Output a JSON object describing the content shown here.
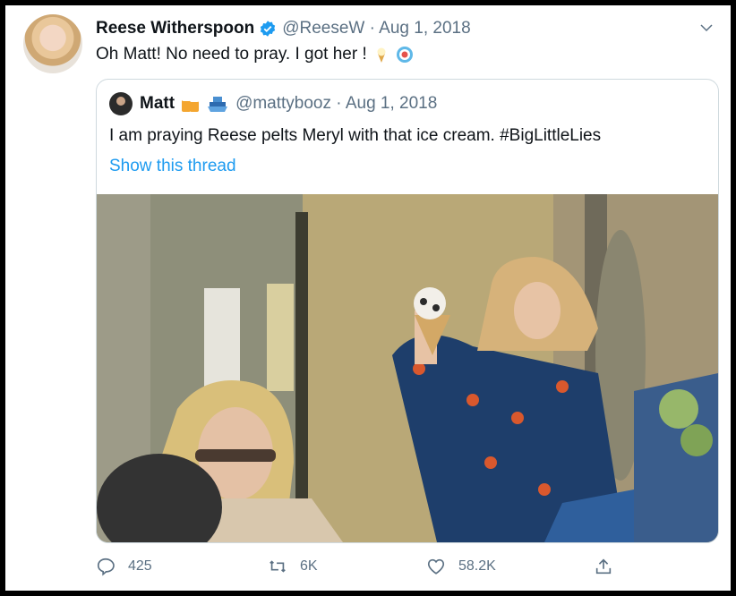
{
  "tweet": {
    "display_name": "Reese Witherspoon",
    "handle_date": "@ReeseW · Aug 1, 2018",
    "text": "Oh Matt! No need to pray. I got her !"
  },
  "quoted": {
    "display_name": "Matt",
    "handle_date": "@mattybooz · Aug 1, 2018",
    "text": "I am praying Reese pelts Meryl with that ice cream. #BigLittleLies",
    "show_thread": "Show this thread"
  },
  "actions": {
    "replies": "425",
    "retweets": "6K",
    "likes": "58.2K"
  },
  "colors": {
    "verified": "#1d9bf0",
    "link": "#1d9bf0",
    "muted": "#5b7083"
  },
  "icons": [
    "verified-badge-icon",
    "chevron-down-icon",
    "ice-cream-emoji",
    "target-emoji",
    "beer-emoji",
    "ship-emoji",
    "reply-icon",
    "retweet-icon",
    "like-icon",
    "share-icon"
  ]
}
